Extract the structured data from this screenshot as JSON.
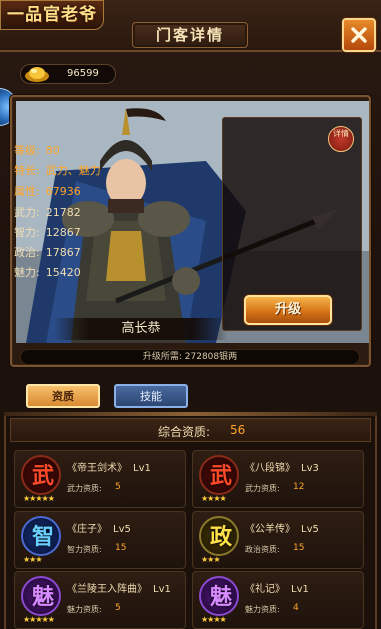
{
  "header": {
    "game_logo": "一品官老爷",
    "title": "门客详情",
    "close_icon": "close-x-icon"
  },
  "currency": {
    "icon": "silver-ingot-icon",
    "value": "96599"
  },
  "hero": {
    "name": "高长恭",
    "detail_seal": "详情",
    "stats": [
      {
        "label": "等级:",
        "value": "80",
        "color": "#ffa52a"
      },
      {
        "label": "特长:",
        "value": "武力、魅力",
        "color": "#ffa52a"
      },
      {
        "label": "属性:",
        "value": "67936",
        "color": "#ffa52a"
      },
      {
        "label": "武力:",
        "value": "21782",
        "color": "#f0dcb0"
      },
      {
        "label": "智力:",
        "value": "12867",
        "color": "#f0dcb0"
      },
      {
        "label": "政治:",
        "value": "17867",
        "color": "#f0dcb0"
      },
      {
        "label": "魅力:",
        "value": "15420",
        "color": "#f0dcb0"
      }
    ],
    "upgrade_label": "升级",
    "upgrade_cost": "升级所需: 272808银两"
  },
  "tabs": [
    {
      "label": "资质",
      "active": true
    },
    {
      "label": "技能",
      "active": false
    }
  ],
  "aptitude": {
    "label": "综合资质:",
    "total": "56",
    "cards": [
      {
        "glyph": "武",
        "color": "red",
        "title": "《帝王剑术》",
        "level": "Lv1",
        "stat_label": "武力资质:",
        "stat_value": "5",
        "stars": "★★★★★"
      },
      {
        "glyph": "武",
        "color": "red",
        "title": "《八段锦》",
        "level": "Lv3",
        "stat_label": "武力资质:",
        "stat_value": "12",
        "stars": "★★★★"
      },
      {
        "glyph": "智",
        "color": "blue",
        "title": "《庄子》",
        "level": "Lv5",
        "stat_label": "智力资质:",
        "stat_value": "15",
        "stars": "★★★"
      },
      {
        "glyph": "政",
        "color": "yellow",
        "title": "《公羊传》",
        "level": "Lv5",
        "stat_label": "政治资质:",
        "stat_value": "15",
        "stars": "★★★"
      },
      {
        "glyph": "魅",
        "color": "purple",
        "title": "《兰陵王入阵曲》",
        "level": "Lv1",
        "stat_label": "魅力资质:",
        "stat_value": "5",
        "stars": "★★★★★"
      },
      {
        "glyph": "魅",
        "color": "purple",
        "title": "《礼记》",
        "level": "Lv1",
        "stat_label": "魅力资质:",
        "stat_value": "4",
        "stars": "★★★★"
      }
    ]
  }
}
